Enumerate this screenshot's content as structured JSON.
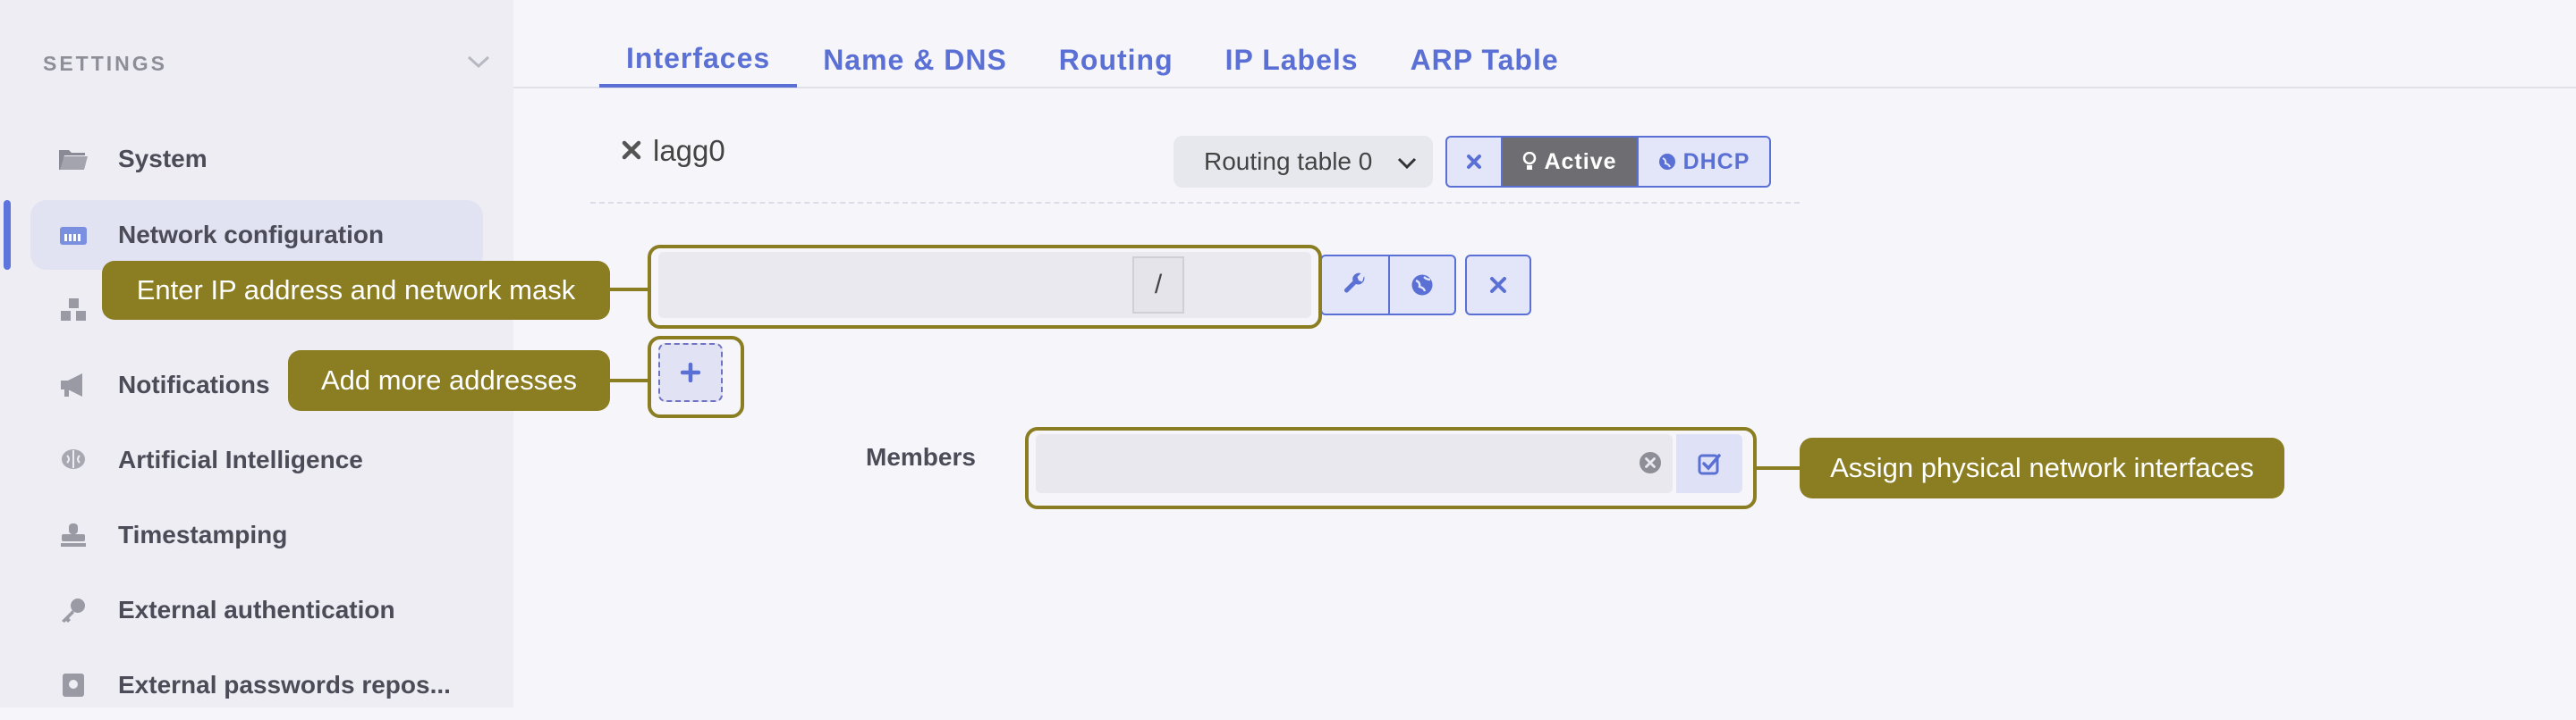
{
  "sidebar": {
    "title": "SETTINGS",
    "items": [
      {
        "label": "System",
        "icon": "folder-icon"
      },
      {
        "label": "Network configuration",
        "icon": "network-icon"
      },
      {
        "label": "",
        "icon": "modules-icon"
      },
      {
        "label": "Notifications",
        "icon": "megaphone-icon"
      },
      {
        "label": "Artificial Intelligence",
        "icon": "brain-icon"
      },
      {
        "label": "Timestamping",
        "icon": "stamp-icon"
      },
      {
        "label": "External authentication",
        "icon": "key-icon"
      },
      {
        "label": "External passwords repos...",
        "icon": "vault-icon"
      }
    ]
  },
  "tabs": [
    {
      "label": "Interfaces"
    },
    {
      "label": "Name & DNS"
    },
    {
      "label": "Routing"
    },
    {
      "label": "IP Labels"
    },
    {
      "label": "ARP Table"
    }
  ],
  "interface": {
    "name": "lagg0",
    "routing_table": "Routing table 0",
    "active_label": "Active",
    "dhcp_label": "DHCP",
    "address_separator": "/",
    "members_label": "Members"
  },
  "callouts": {
    "address": "Enter IP address and network mask",
    "add": "Add more addresses",
    "members": "Assign physical network interfaces"
  },
  "colors": {
    "accent": "#5b70d4",
    "callout": "#8a7d22",
    "sidebar_bg": "#ededf3"
  }
}
